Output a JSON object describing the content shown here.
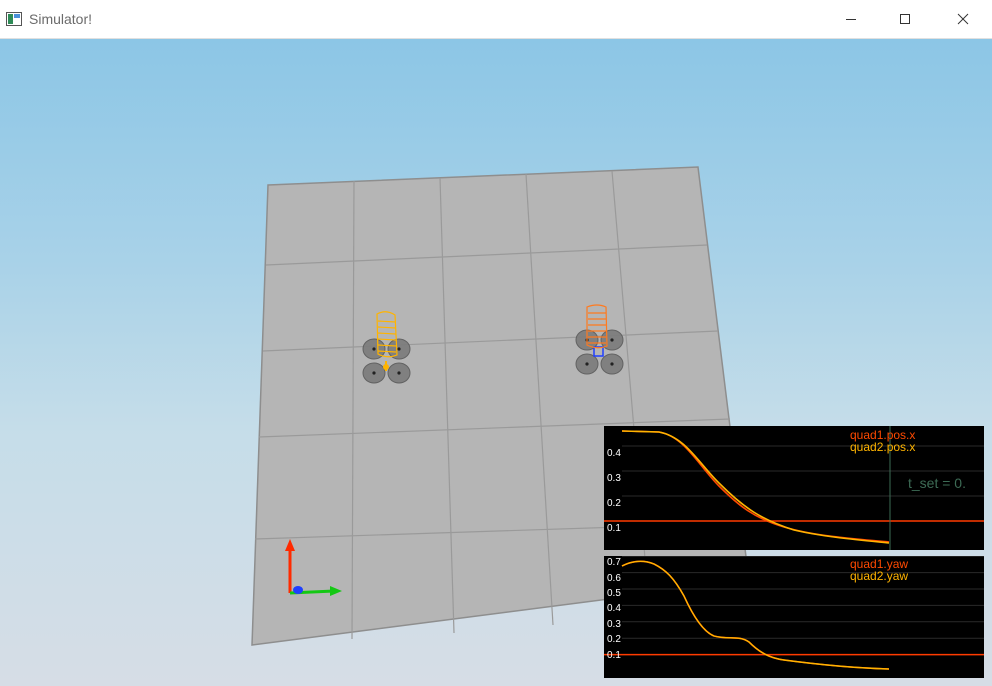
{
  "window": {
    "title": "Simulator!",
    "controls": [
      "minimize",
      "maximize",
      "close"
    ]
  },
  "scene": {
    "quad1_color": "#ff7a1f",
    "quad2_color": "#ffb400",
    "floor_color": "#b5b5b5",
    "axes": {
      "x_color": "#14c814",
      "y_color": "#ff2a00",
      "z_color": "#1f3fff"
    }
  },
  "plots": [
    {
      "legend": [
        {
          "label": "quad1.pos.x",
          "color": "#ff4a00"
        },
        {
          "label": "quad2.pos.x",
          "color": "#ffb400"
        }
      ],
      "y_ticks": [
        "0.4",
        "0.3",
        "0.2",
        "0.1"
      ],
      "y_range": [
        0.0,
        0.5
      ],
      "reference_value": 0.1,
      "annotation": "t_set  =  0."
    },
    {
      "legend": [
        {
          "label": "quad1.yaw",
          "color": "#ff4a00"
        },
        {
          "label": "quad2.yaw",
          "color": "#ffb400"
        }
      ],
      "y_ticks": [
        "0.7",
        "0.6",
        "0.5",
        "0.4",
        "0.3",
        "0.2",
        "0.1"
      ],
      "y_range": [
        0.0,
        0.75
      ],
      "reference_value": 0.1
    }
  ]
}
